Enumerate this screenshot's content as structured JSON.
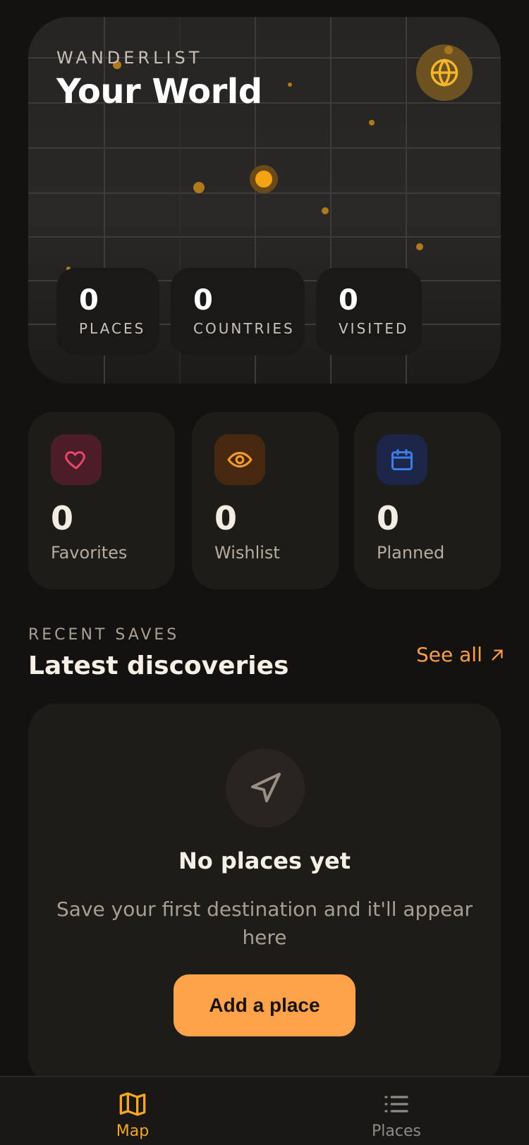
{
  "hero": {
    "eyebrow": "WANDERLIST",
    "title": "Your World",
    "stats": [
      {
        "value": "0",
        "label": "PLACES"
      },
      {
        "value": "0",
        "label": "COUNTRIES"
      },
      {
        "value": "0",
        "label": "VISITED"
      }
    ]
  },
  "categories": [
    {
      "value": "0",
      "label": "Favorites",
      "icon": "heart-icon",
      "color": "#e8476a"
    },
    {
      "value": "0",
      "label": "Wishlist",
      "icon": "eye-icon",
      "color": "#f29a2e"
    },
    {
      "value": "0",
      "label": "Planned",
      "icon": "calendar-icon",
      "color": "#3d7dea"
    }
  ],
  "recent": {
    "eyebrow": "RECENT SAVES",
    "title": "Latest discoveries",
    "see_all": "See all"
  },
  "empty_state": {
    "icon": "navigation-arrow-icon",
    "title": "No places yet",
    "description": "Save your first destination and it'll appear here",
    "button": "Add a place"
  },
  "bottom_nav": [
    {
      "label": "Map",
      "icon": "map-icon",
      "active": true
    },
    {
      "label": "Places",
      "icon": "list-icon",
      "active": false
    }
  ],
  "colors": {
    "accent": "#ffa24a",
    "background": "#141210",
    "card": "#1e1c19"
  }
}
